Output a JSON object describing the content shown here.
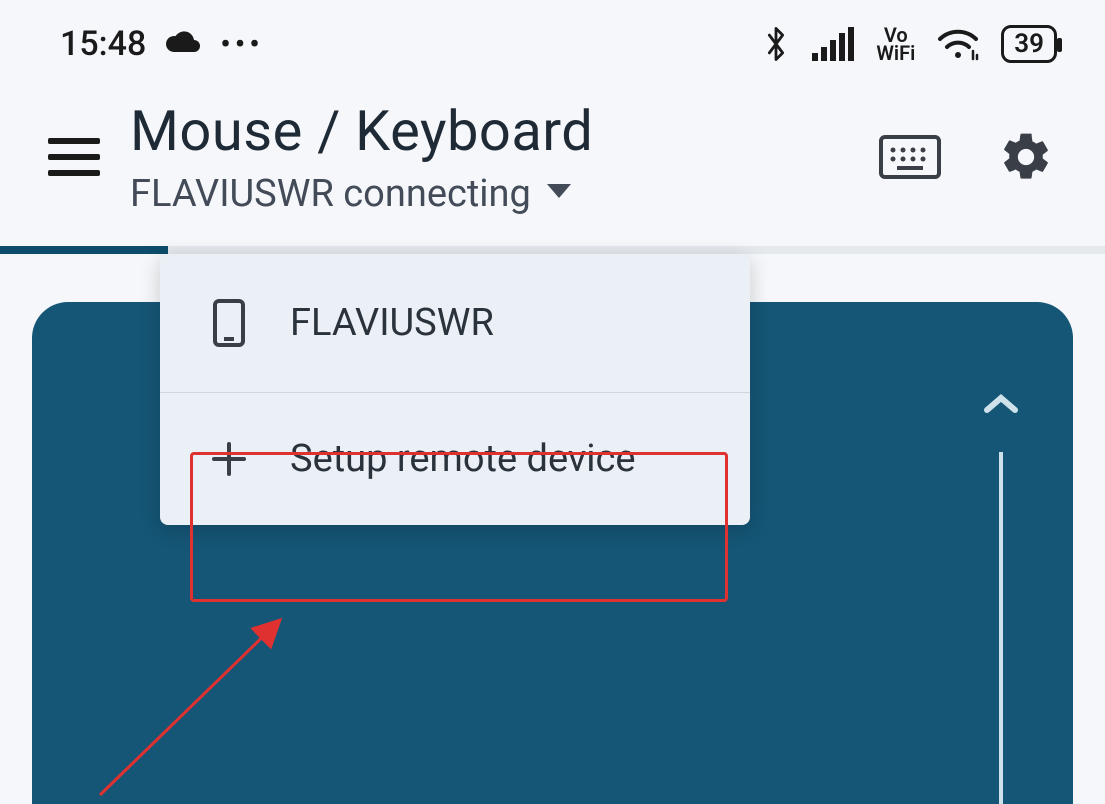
{
  "status_bar": {
    "time": "15:48",
    "battery": "39",
    "vo_wifi_top": "Vo",
    "vo_wifi_bottom": "WiFi"
  },
  "app_bar": {
    "title": "Mouse / Keyboard",
    "subtitle": "FLAVIUSWR connecting"
  },
  "popup": {
    "device_name": "FLAVIUSWR",
    "setup_label": "Setup remote device"
  },
  "colors": {
    "touchpad": "#155575",
    "highlight": "#e03131"
  }
}
